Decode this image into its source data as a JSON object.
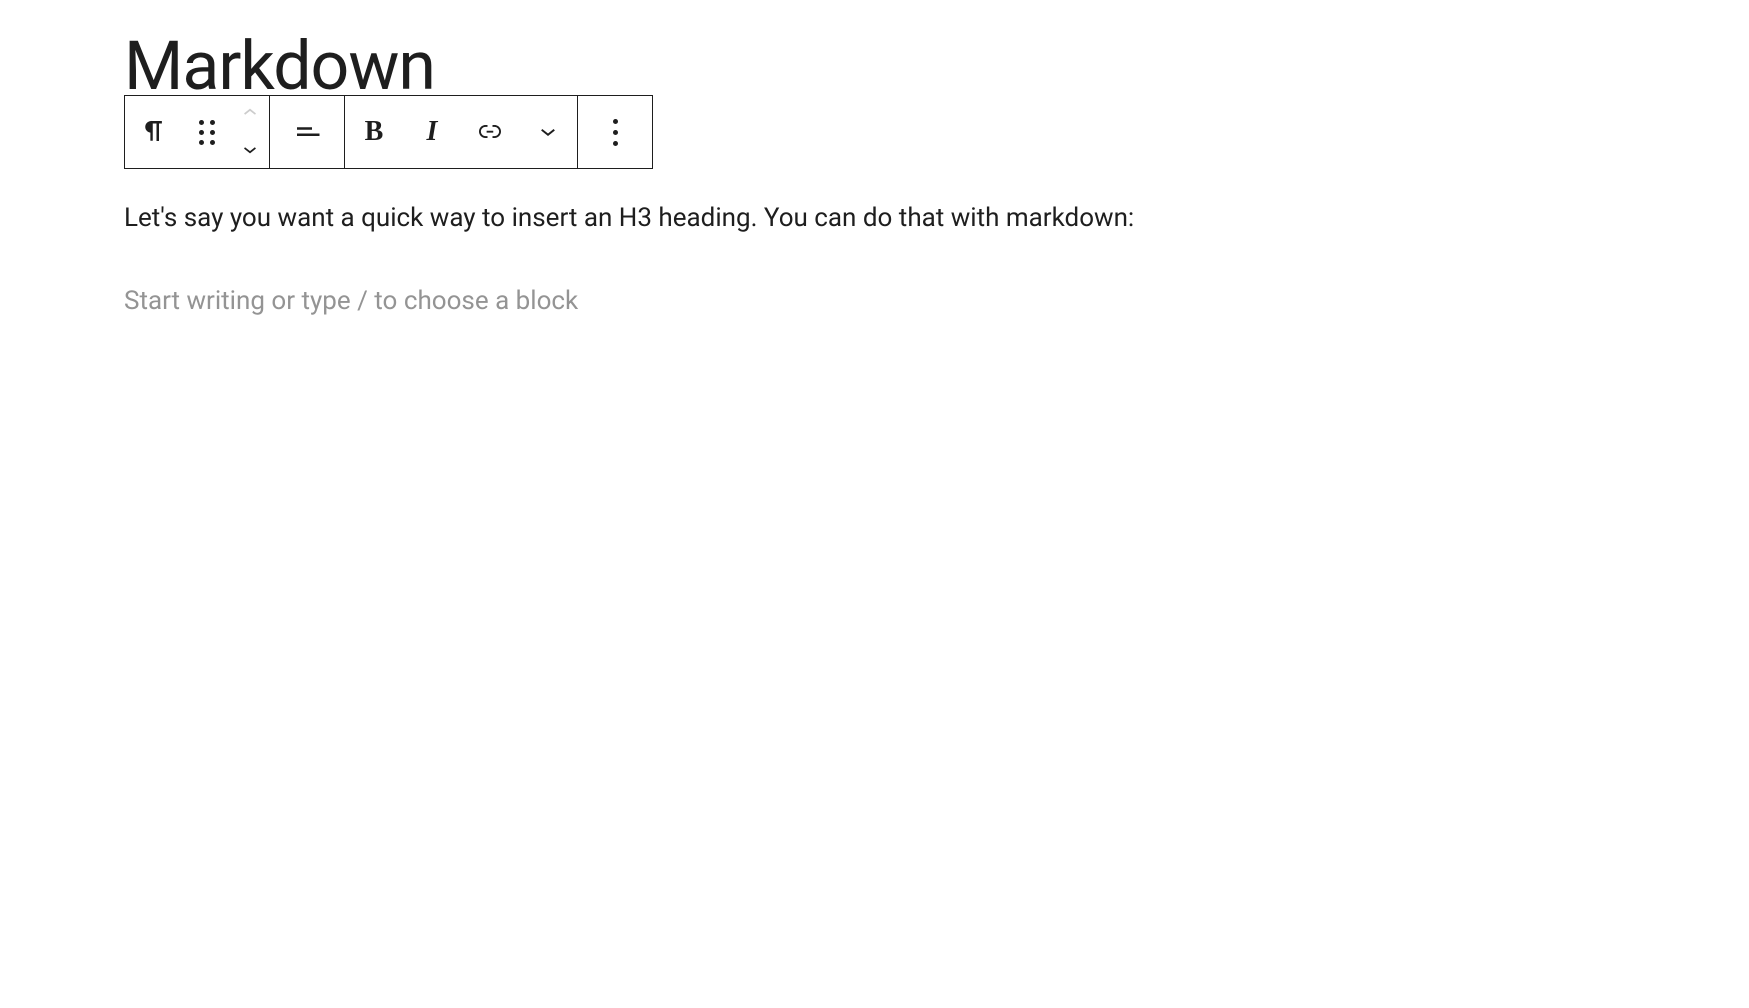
{
  "title": "Markdown",
  "toolbar": {
    "paragraph_icon": "pilcrow-icon",
    "drag_icon": "drag-handle-icon",
    "move_up_icon": "chevron-up-icon",
    "move_down_icon": "chevron-down-icon",
    "align_icon": "align-left-icon",
    "bold_label": "B",
    "italic_label": "I",
    "link_icon": "link-icon",
    "more_format_icon": "chevron-down-icon",
    "options_icon": "more-vertical-icon"
  },
  "content": {
    "paragraph1": "Let's say you want a quick way to insert an H3 heading. You can do that with markdown:",
    "placeholder": "Start writing or type / to choose a block"
  }
}
